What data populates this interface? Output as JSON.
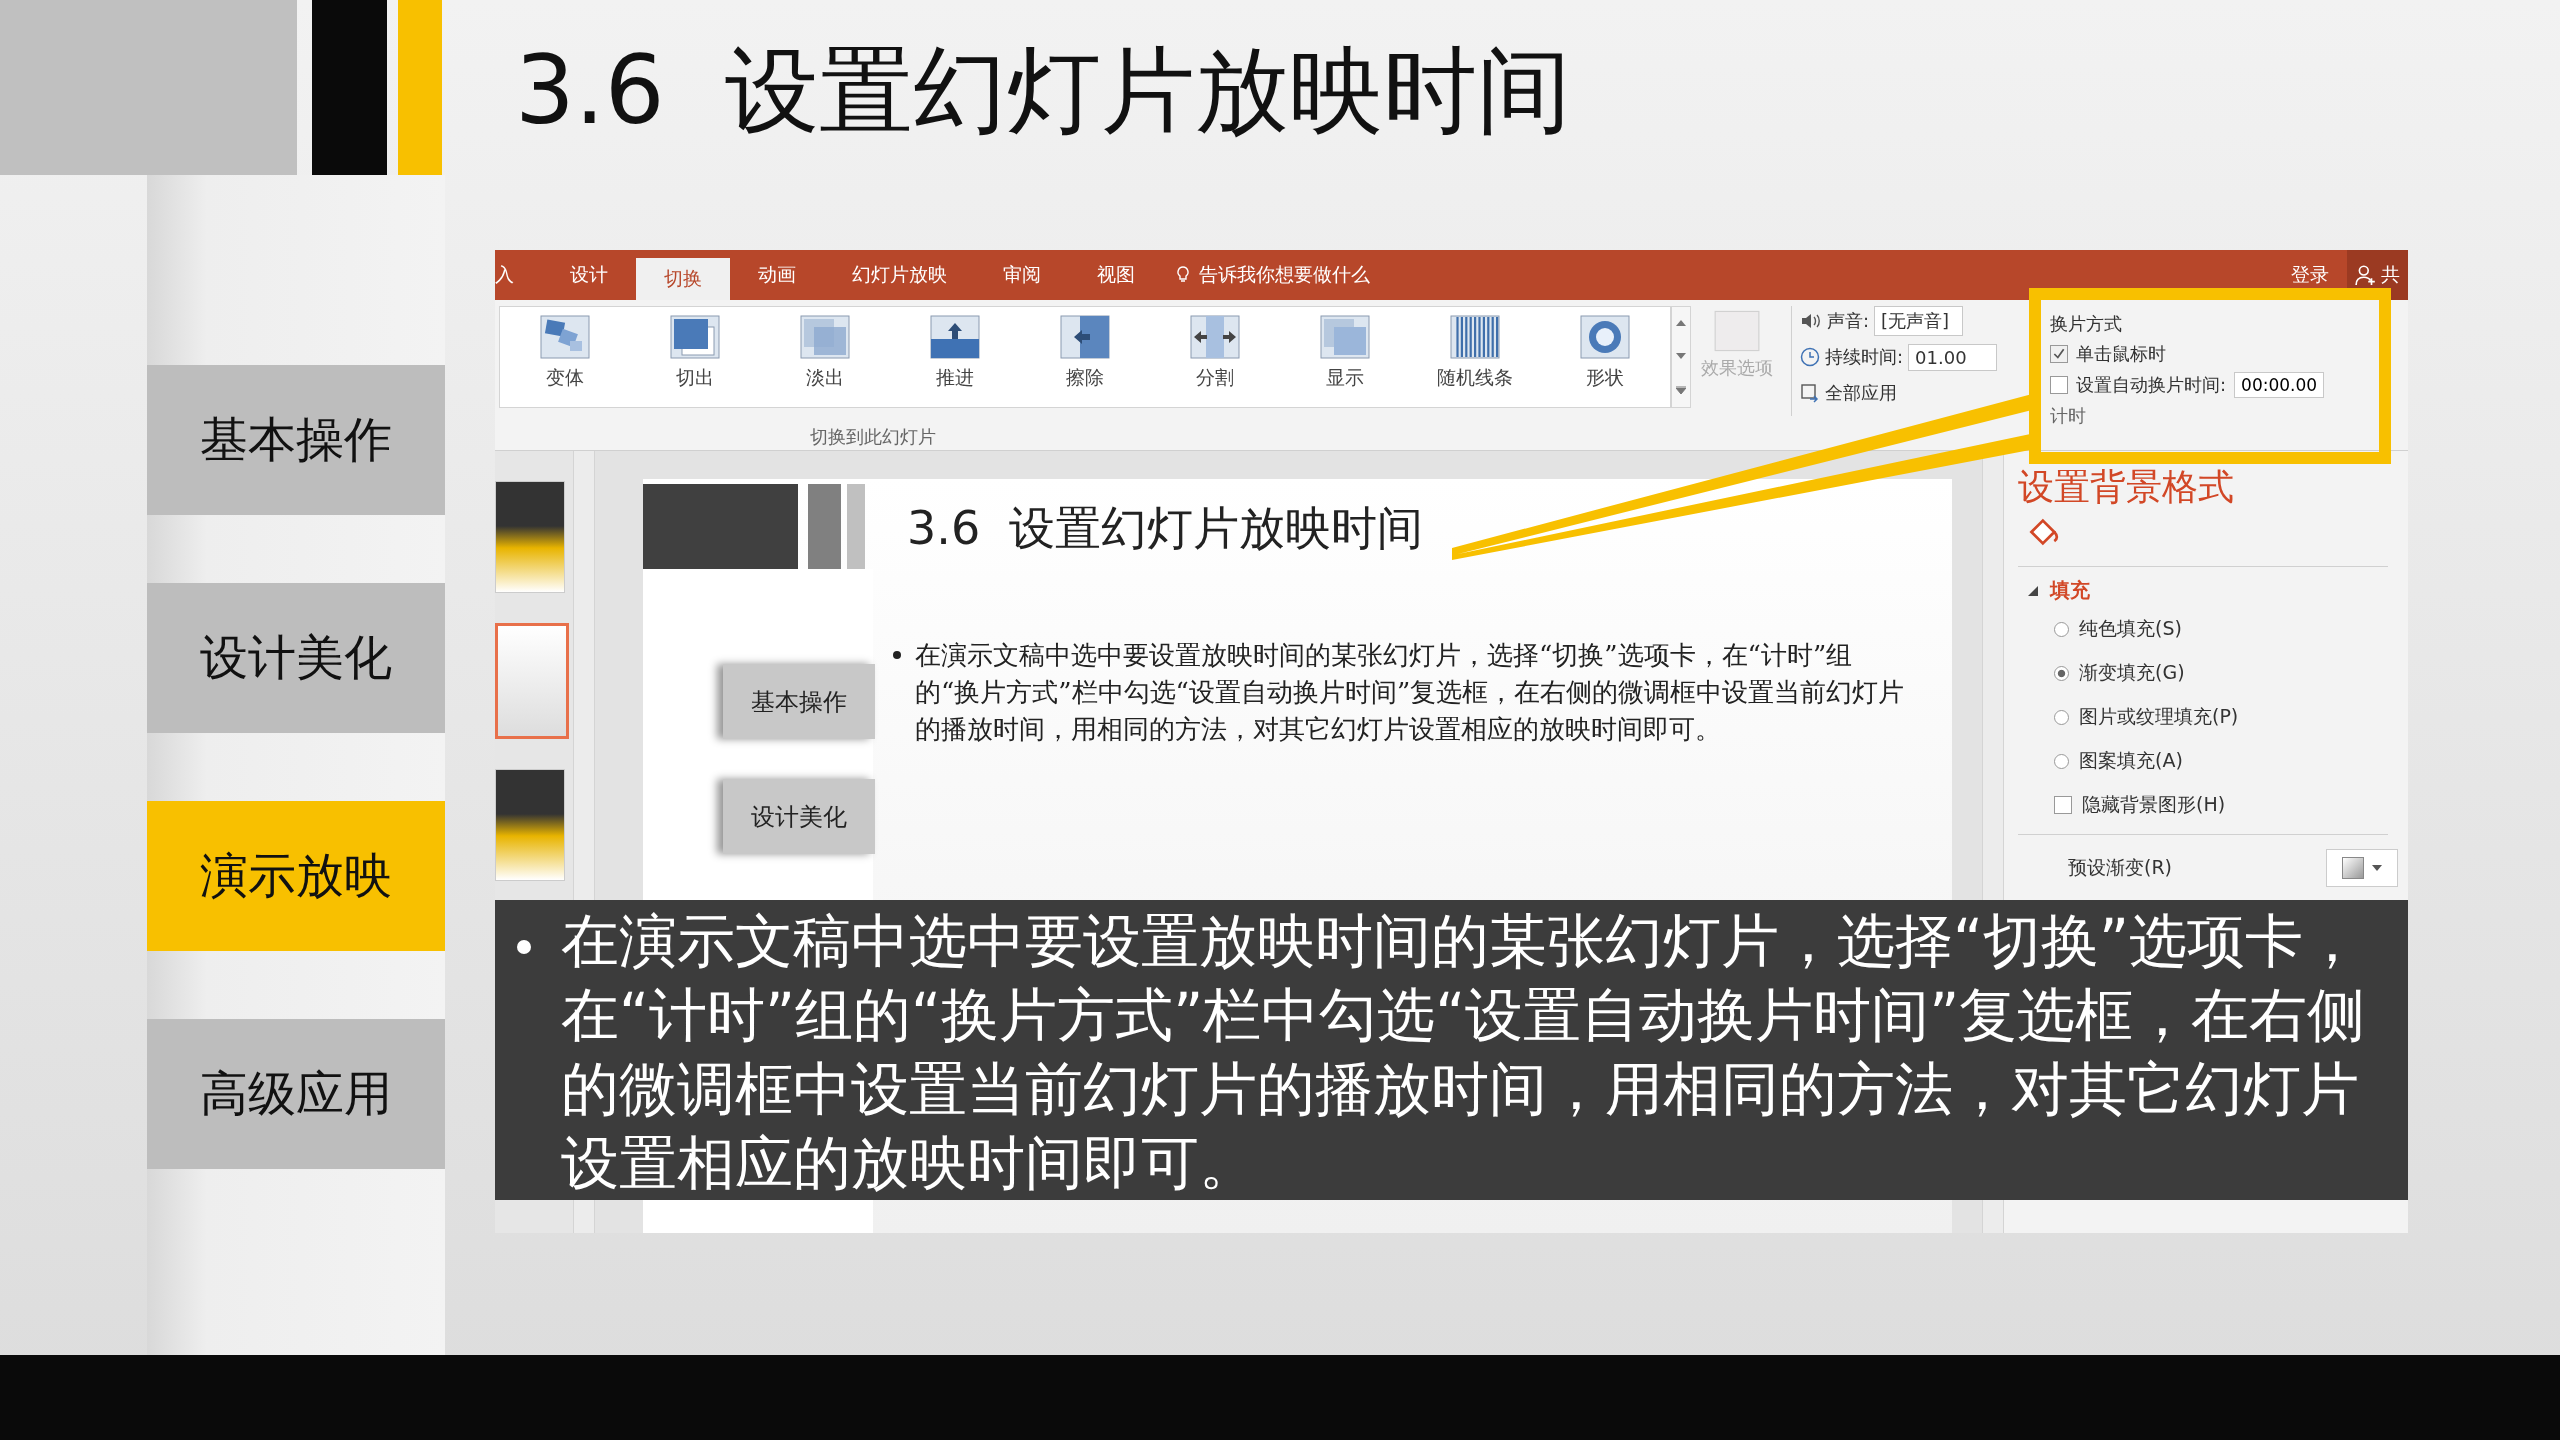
{
  "title": {
    "number": "3.6",
    "text": "设置幻灯片放映时间"
  },
  "nav": [
    {
      "label": "基本操作",
      "selected": false
    },
    {
      "label": "设计美化",
      "selected": false
    },
    {
      "label": "演示放映",
      "selected": true
    },
    {
      "label": "高级应用",
      "selected": false
    }
  ],
  "app": {
    "tabs": [
      {
        "label": "入",
        "selected": false
      },
      {
        "label": "设计",
        "selected": false
      },
      {
        "label": "切换",
        "selected": true
      },
      {
        "label": "动画",
        "selected": false
      },
      {
        "label": "幻灯片放映",
        "selected": false
      },
      {
        "label": "审阅",
        "selected": false
      },
      {
        "label": "视图",
        "selected": false
      }
    ],
    "tell_me": "告诉我你想要做什么",
    "sign_in": "登录",
    "share": "共",
    "transitions": [
      {
        "label": "变体",
        "kind": "morph"
      },
      {
        "label": "切出",
        "kind": "cut"
      },
      {
        "label": "淡出",
        "kind": "fade"
      },
      {
        "label": "推进",
        "kind": "push"
      },
      {
        "label": "擦除",
        "kind": "wipe"
      },
      {
        "label": "分割",
        "kind": "split"
      },
      {
        "label": "显示",
        "kind": "reveal"
      },
      {
        "label": "随机线条",
        "kind": "bars"
      },
      {
        "label": "形状",
        "kind": "shape"
      }
    ],
    "effect_options": {
      "label": "效果选项",
      "disabled": true
    },
    "transition_group": "切换到此幻灯片",
    "sound": {
      "label": "声音:",
      "value": "[无声音]"
    },
    "duration": {
      "label": "持续时间:",
      "value": "01.00"
    },
    "apply_all": "全部应用",
    "timing": {
      "title": "换片方式",
      "on_click": {
        "label": "单击鼠标时",
        "checked": true
      },
      "auto": {
        "label": "设置自动换片时间:",
        "checked": false,
        "value": "00:00.00"
      },
      "group": "计时"
    },
    "thumbnails": [
      {
        "selected": false
      },
      {
        "selected": true
      },
      {
        "selected": false
      }
    ],
    "slide": {
      "title": "3.6  设置幻灯片放映时间",
      "nav": [
        "基本操作",
        "设计美化"
      ],
      "bullet": "在演示文稿中选中要设置放映时间的某张幻灯片，选择“切换”选项卡，在“计时”组的“换片方式”栏中勾选“设置自动换片时间”复选框，在右侧的微调框中设置当前幻灯片的播放时间，用相同的方法，对其它幻灯片设置相应的放映时间即可。"
    },
    "pane": {
      "title": "设置背景格式",
      "section": "填充",
      "options": [
        {
          "kind": "radio",
          "label": "纯色填充(S)",
          "selected": false
        },
        {
          "kind": "radio",
          "label": "渐变填充(G)",
          "selected": true
        },
        {
          "kind": "radio",
          "label": "图片或纹理填充(P)",
          "selected": false
        },
        {
          "kind": "radio",
          "label": "图案填充(A)",
          "selected": false
        },
        {
          "kind": "checkbox",
          "label": "隐藏背景图形(H)",
          "checked": false
        }
      ],
      "preset": "预设渐变(R)"
    }
  },
  "caption": "在演示文稿中选中要设置放映时间的某张幻灯片，选择“切换”选项卡，在“计时”组的“换片方式”栏中勾选“设置自动换片时间”复选框，在右侧的微调框中设置当前幻灯片的播放时间，用相同的方法，对其它幻灯片设置相应的放映时间即可。"
}
